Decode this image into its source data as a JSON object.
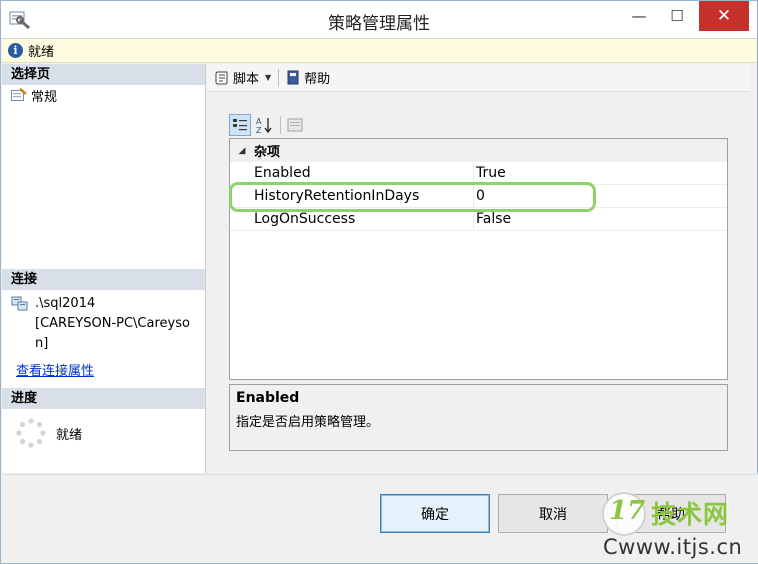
{
  "window": {
    "title": "策略管理属性",
    "min_glyph": "—",
    "max_glyph": "☐",
    "close_glyph": "✕"
  },
  "status": {
    "text": "就绪"
  },
  "left": {
    "select_page_header": "选择页",
    "pages": [
      {
        "label": "常规",
        "icon": "wrench-page-icon"
      }
    ],
    "connection_header": "连接",
    "connection_server": ".\\sql2014",
    "connection_user": "[CAREYSON-PC\\Careyson]",
    "connection_link": "查看连接属性",
    "progress_header": "进度",
    "progress_text": "就绪"
  },
  "toolbar": {
    "script_label": "脚本",
    "help_label": "帮助"
  },
  "propgrid": {
    "category": "杂项",
    "rows": [
      {
        "name": "Enabled",
        "value": "True"
      },
      {
        "name": "HistoryRetentionInDays",
        "value": "0"
      },
      {
        "name": "LogOnSuccess",
        "value": "False"
      }
    ],
    "desc_title": "Enabled",
    "desc_text": "指定是否启用策略管理。"
  },
  "buttons": {
    "ok": "确定",
    "cancel": "取消",
    "help": "帮助"
  },
  "watermark": {
    "num": "17",
    "cn": "技术网",
    "url": "Cwww.itjs.cn"
  },
  "colors": {
    "highlight": "#8fd16b",
    "link": "#0033cc",
    "close": "#c7312b"
  }
}
